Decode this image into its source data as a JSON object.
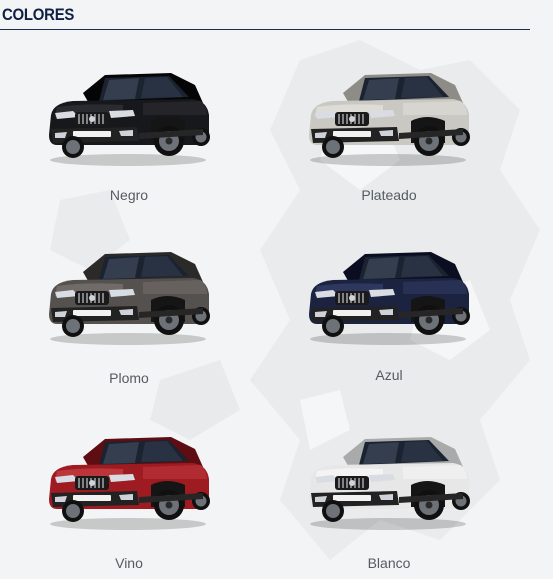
{
  "section": {
    "title": "COLORES"
  },
  "colors": [
    {
      "name": "Negro",
      "body": "#17181b",
      "shade": "#050506",
      "light": "#3b3d44"
    },
    {
      "name": "Plateado",
      "body": "#c9c8c2",
      "shade": "#8d8c87",
      "light": "#eeede8"
    },
    {
      "name": "Plomo",
      "body": "#55514f",
      "shade": "#2c2a29",
      "light": "#87827f"
    },
    {
      "name": "Azul",
      "body": "#1c2340",
      "shade": "#0a0e20",
      "light": "#3e4b78"
    },
    {
      "name": "Vino",
      "body": "#9e1b22",
      "shade": "#5e0d12",
      "light": "#d44a4f"
    },
    {
      "name": "Blanco",
      "body": "#e6e7e6",
      "shade": "#a9abab",
      "light": "#ffffff"
    }
  ]
}
